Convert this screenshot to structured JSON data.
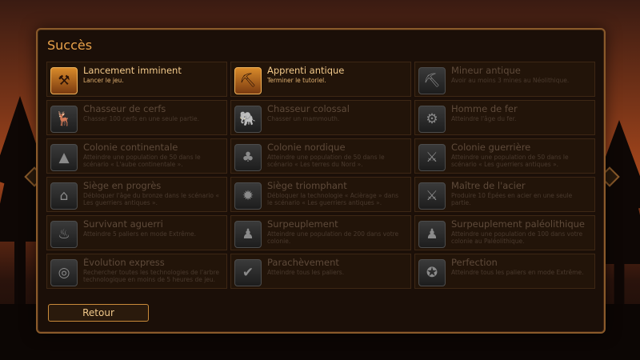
{
  "title": "Succès",
  "back_label": "Retour",
  "achievements": [
    {
      "name": "Lancement imminent",
      "desc": "Lancer le jeu.",
      "unlocked": true,
      "icon": "⚒"
    },
    {
      "name": "Apprenti antique",
      "desc": "Terminer le tutoriel.",
      "unlocked": true,
      "icon": "⛏"
    },
    {
      "name": "Mineur antique",
      "desc": "Avoir au moins 3 mines au Néolithique.",
      "unlocked": false,
      "icon": "⛏"
    },
    {
      "name": "Chasseur de cerfs",
      "desc": "Chasser 100 cerfs en une seule partie.",
      "unlocked": false,
      "icon": "🦌"
    },
    {
      "name": "Chasseur colossal",
      "desc": "Chasser un mammouth.",
      "unlocked": false,
      "icon": "🐘"
    },
    {
      "name": "Homme de fer",
      "desc": "Atteindre l'âge du fer.",
      "unlocked": false,
      "icon": "⚙"
    },
    {
      "name": "Colonie continentale",
      "desc": "Atteindre une population de 50 dans le scénario « L'aube continentale ».",
      "unlocked": false,
      "icon": "▲"
    },
    {
      "name": "Colonie nordique",
      "desc": "Atteindre une population de 50 dans le scénario « Les terres du Nord ».",
      "unlocked": false,
      "icon": "♣"
    },
    {
      "name": "Colonie guerrière",
      "desc": "Atteindre une population de 50 dans le scénario « Les guerriers antiques ».",
      "unlocked": false,
      "icon": "⚔"
    },
    {
      "name": "Siège en progrès",
      "desc": "Débloquer l'âge du bronze dans le scénario « Les guerriers antiques ».",
      "unlocked": false,
      "icon": "⌂"
    },
    {
      "name": "Siège triomphant",
      "desc": "Débloquer la technologie « Acièrage » dans le scénario « Les guerriers antiques ».",
      "unlocked": false,
      "icon": "✹"
    },
    {
      "name": "Maître de l'acier",
      "desc": "Produire 10 Épées en acier en une seule partie.",
      "unlocked": false,
      "icon": "⚔"
    },
    {
      "name": "Survivant aguerri",
      "desc": "Atteindre 5 paliers en mode Extrême.",
      "unlocked": false,
      "icon": "♨"
    },
    {
      "name": "Surpeuplement",
      "desc": "Atteindre une population de 200 dans votre colonie.",
      "unlocked": false,
      "icon": "♟"
    },
    {
      "name": "Surpeuplement paléolithique",
      "desc": "Atteindre une population de 100 dans votre colonie au Paléolithique.",
      "unlocked": false,
      "icon": "♟"
    },
    {
      "name": "Évolution express",
      "desc": "Rechercher toutes les technologies de l'arbre technologique en moins de 5 heures de jeu.",
      "unlocked": false,
      "icon": "◎"
    },
    {
      "name": "Parachèvement",
      "desc": "Atteindre tous les paliers.",
      "unlocked": false,
      "icon": "✔"
    },
    {
      "name": "Perfection",
      "desc": "Atteindre tous les paliers en mode Extrême.",
      "unlocked": false,
      "icon": "✪"
    }
  ]
}
